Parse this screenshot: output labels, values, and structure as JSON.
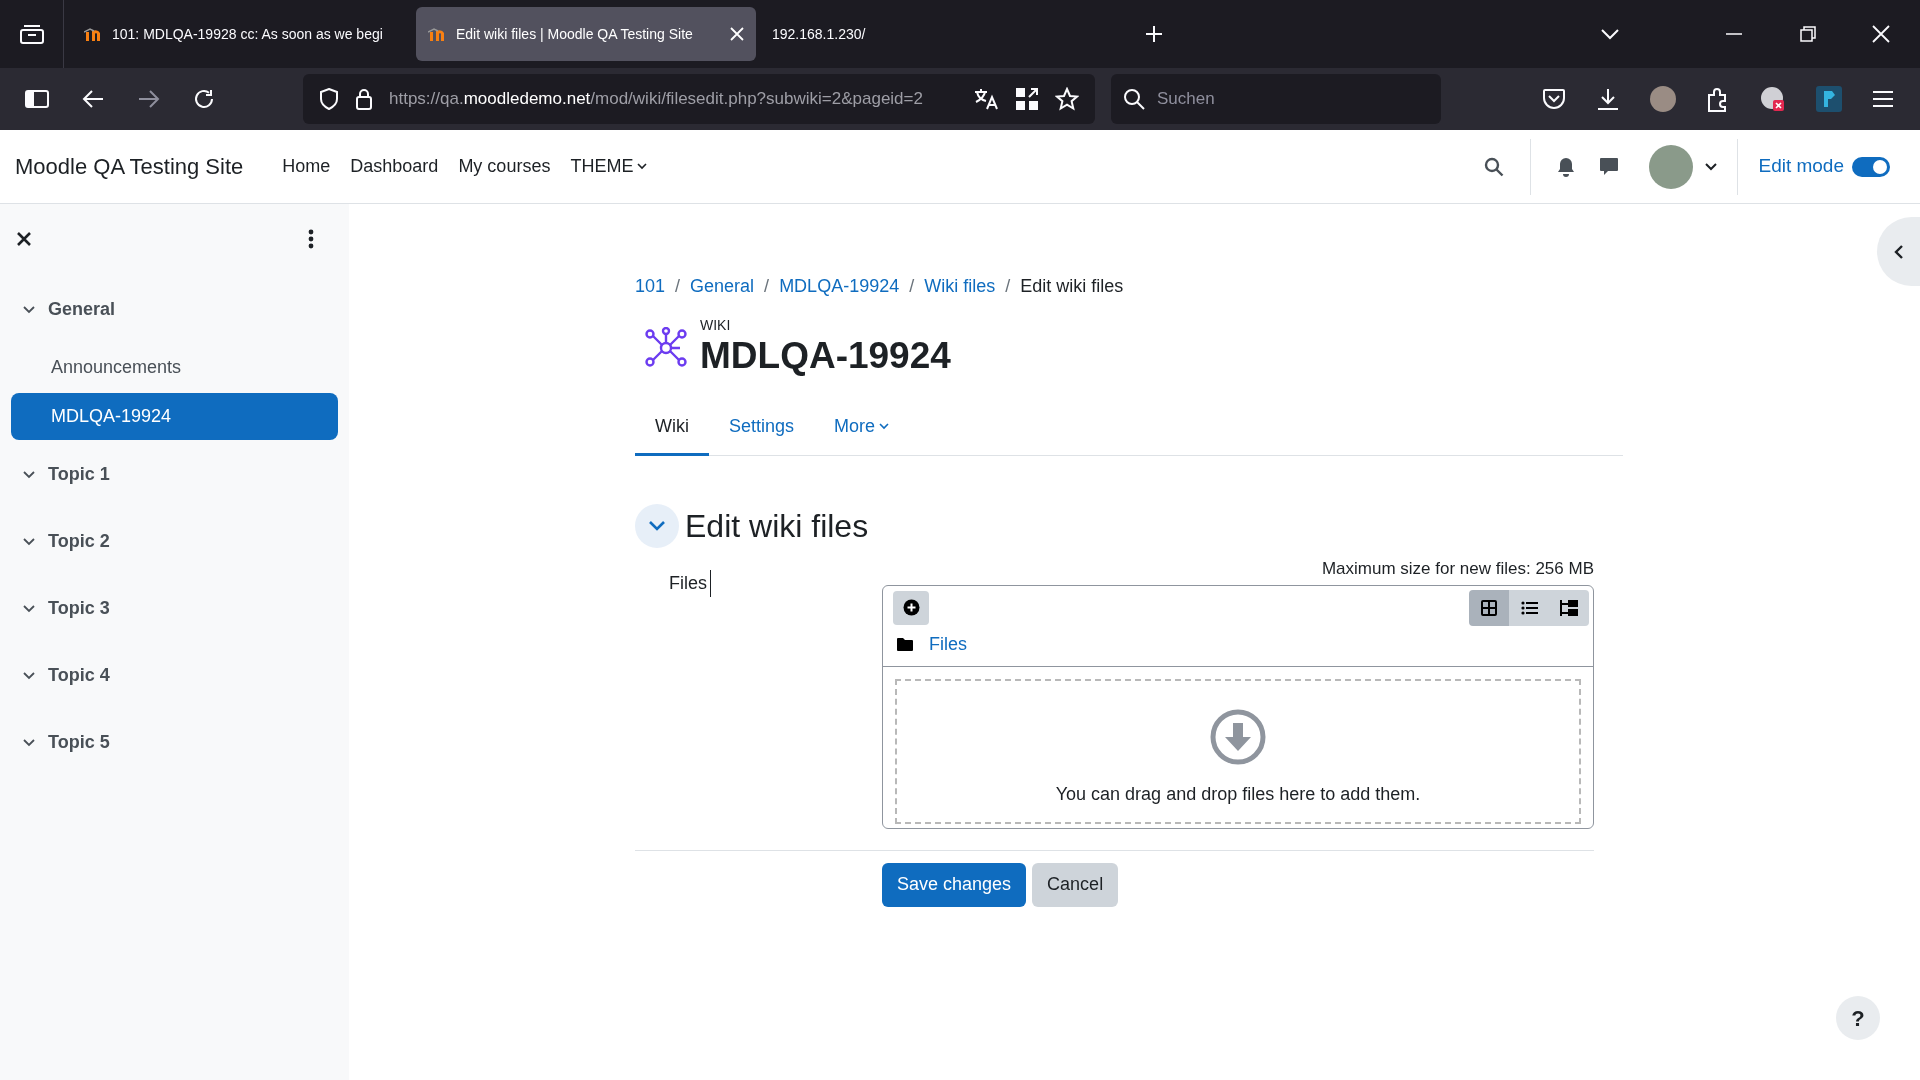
{
  "browser": {
    "tabs": [
      {
        "title": "101: MDLQA-19928 cc: As soon as we begi",
        "selected": false,
        "kind": "site"
      },
      {
        "title": "Edit wiki files | Moodle QA Testing Site",
        "selected": true,
        "kind": "site"
      },
      {
        "title": "192.168.1.230/",
        "selected": false,
        "kind": "plain"
      }
    ],
    "url": {
      "prefix": "https://qa.",
      "domain": "moodledemo.net",
      "path": "/mod/wiki/filesedit.php?subwiki=2&pageid=2"
    },
    "search": {
      "placeholder": "Suchen"
    }
  },
  "header": {
    "site_name": "Moodle QA Testing Site",
    "nav": [
      {
        "label": "Home",
        "dropdown": false
      },
      {
        "label": "Dashboard",
        "dropdown": false
      },
      {
        "label": "My courses",
        "dropdown": false
      },
      {
        "label": "THEME",
        "dropdown": true
      }
    ],
    "edit_mode": {
      "label": "Edit mode",
      "on": true
    }
  },
  "sidebar": {
    "items": [
      {
        "label": "General",
        "kind": "section",
        "expanded": true,
        "selected": false,
        "children": [
          {
            "label": "Announcements",
            "kind": "activity",
            "selected": false
          },
          {
            "label": "MDLQA-19924",
            "kind": "activity",
            "selected": true
          }
        ]
      },
      {
        "label": "Topic 1",
        "kind": "section",
        "expanded": true,
        "selected": false
      },
      {
        "label": "Topic 2",
        "kind": "section",
        "expanded": true,
        "selected": false
      },
      {
        "label": "Topic 3",
        "kind": "section",
        "expanded": true,
        "selected": false
      },
      {
        "label": "Topic 4",
        "kind": "section",
        "expanded": true,
        "selected": false
      },
      {
        "label": "Topic 5",
        "kind": "section",
        "expanded": true,
        "selected": false
      }
    ]
  },
  "breadcrumb": [
    {
      "label": "101",
      "link": true
    },
    {
      "separator": "/",
      "label": "General",
      "link": true
    },
    {
      "separator": "/",
      "label": "MDLQA-19924",
      "link": true
    },
    {
      "separator": "/",
      "label": "Wiki files",
      "link": true
    },
    {
      "separator": "/",
      "label": "Edit wiki files",
      "link": false
    }
  ],
  "activity": {
    "type_label": "WIKI",
    "title": "MDLQA-19924"
  },
  "tabs": [
    {
      "label": "Wiki",
      "selected": true,
      "dropdown": false
    },
    {
      "label": "Settings",
      "selected": false,
      "dropdown": false
    },
    {
      "label": "More",
      "selected": false,
      "dropdown": true
    }
  ],
  "section": {
    "title": "Edit wiki files",
    "expanded": true
  },
  "form": {
    "field_label": "Files",
    "max_size": "Maximum size for new files: 256 MB",
    "path": "Files",
    "views": [
      {
        "kind": "grid",
        "selected": true
      },
      {
        "kind": "list",
        "selected": false
      },
      {
        "kind": "tree",
        "selected": false
      }
    ],
    "dropzone_text": "You can drag and drop files here to add them."
  },
  "buttons": [
    {
      "label": "Save changes",
      "kind": "primary"
    },
    {
      "label": "Cancel",
      "kind": "secondary"
    }
  ],
  "help": "?"
}
